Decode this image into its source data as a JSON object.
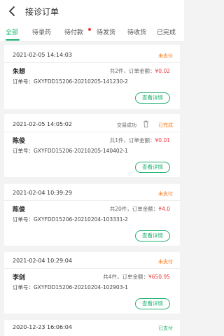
{
  "header": {
    "title": "接诊订单"
  },
  "tabs": [
    "全部",
    "待录药",
    "待付款",
    "待发货",
    "待收货",
    "已完成"
  ],
  "orders": [
    {
      "date": "2021-02-05 14:14:03",
      "status": "未支付",
      "name": "朱想",
      "summary_prefix": "共2件，订单金额：",
      "amount": "¥0.02",
      "order_no": "订单号：GXYFDD15206-20210205-141230-2",
      "btn": "查看详情"
    },
    {
      "date": "2021-02-05 14:05:02",
      "meta": "交易成功",
      "status": "已完成",
      "name": "陈俊",
      "summary_prefix": "共1件，订单金额：",
      "amount": "¥0.01",
      "order_no": "订单号：GXYFDD15206-20210205-140402-1",
      "btn": "查看详情"
    },
    {
      "date": "2021-02-04 10:39:29",
      "status": "未支付",
      "name": "陈俊",
      "summary_prefix": "共20件，订单金额：",
      "amount": "¥4.0",
      "order_no": "订单号：GXYFDD15206-20210204-103331-2",
      "btn": "查看详情"
    },
    {
      "date": "2021-02-04 10:29:04",
      "status": "未支付",
      "name": "李剑",
      "summary_prefix": "共4件，订单金额：",
      "amount": "¥650.95",
      "order_no": "订单号：GXYFDD15206-20210204-102903-1",
      "btn": "查看详情"
    },
    {
      "date": "2020-12-23 16:06:04",
      "status": "已支付"
    }
  ],
  "colors": {
    "accent": "#1fb06f",
    "warning": "#ff7a1a",
    "price": "#e4393c"
  },
  "icons": {
    "back": "back-arrow-icon",
    "trash": "trash-icon"
  }
}
